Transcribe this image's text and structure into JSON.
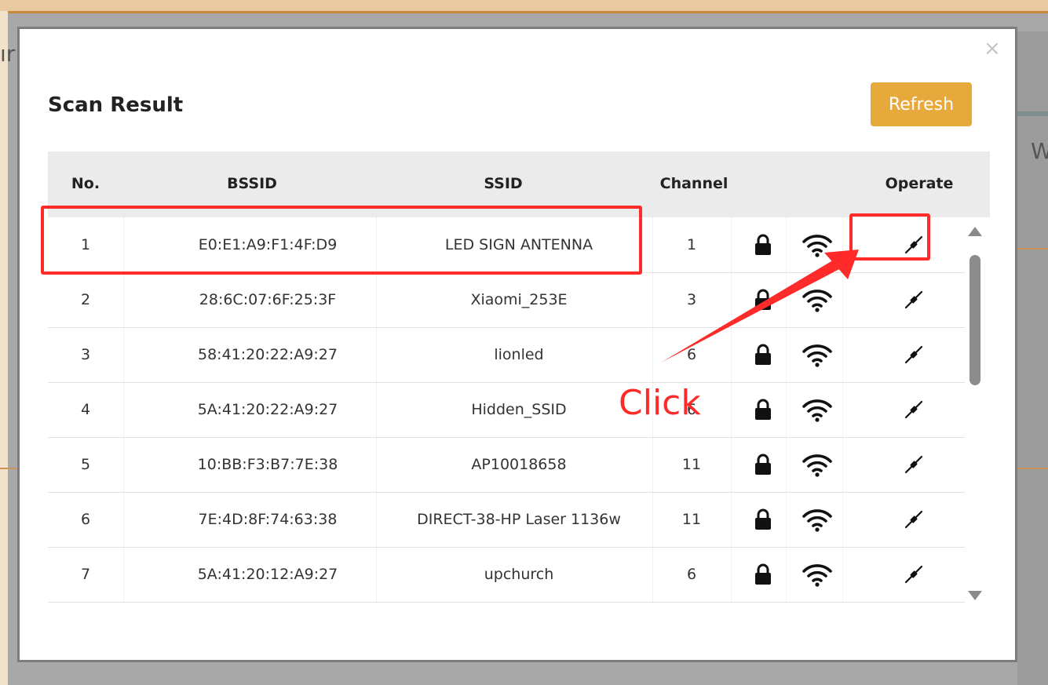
{
  "modal": {
    "title": "Scan Result",
    "refresh_label": "Refresh",
    "close_glyph": "×"
  },
  "table": {
    "headers": {
      "no": "No.",
      "bssid": "BSSID",
      "ssid": "SSID",
      "channel": "Channel",
      "operate": "Operate"
    },
    "rows": [
      {
        "no": "1",
        "bssid": "E0:E1:A9:F1:4F:D9",
        "ssid": "LED SIGN ANTENNA",
        "channel": "1"
      },
      {
        "no": "2",
        "bssid": "28:6C:07:6F:25:3F",
        "ssid": "Xiaomi_253E",
        "channel": "3"
      },
      {
        "no": "3",
        "bssid": "58:41:20:22:A9:27",
        "ssid": "lionled",
        "channel": "6"
      },
      {
        "no": "4",
        "bssid": "5A:41:20:22:A9:27",
        "ssid": "Hidden_SSID",
        "channel": "6"
      },
      {
        "no": "5",
        "bssid": "10:BB:F3:B7:7E:38",
        "ssid": "AP10018658",
        "channel": "11"
      },
      {
        "no": "6",
        "bssid": "7E:4D:8F:74:63:38",
        "ssid": "DIRECT-38-HP Laser 1136w",
        "channel": "11"
      },
      {
        "no": "7",
        "bssid": "5A:41:20:12:A9:27",
        "ssid": "upchurch",
        "channel": "6"
      }
    ]
  },
  "annotation": {
    "click_label": "Click",
    "color": "#ff2a2a"
  },
  "background": {
    "left_fragment": "ır",
    "right_fragment": "W"
  },
  "icons": {
    "lock": "lock-icon",
    "wifi": "wifi-icon",
    "operate": "connect-plug-icon"
  },
  "colors": {
    "refresh_button": "#e8a93c",
    "header_bg": "#ebebeb",
    "highlight": "#ff2a2a"
  }
}
